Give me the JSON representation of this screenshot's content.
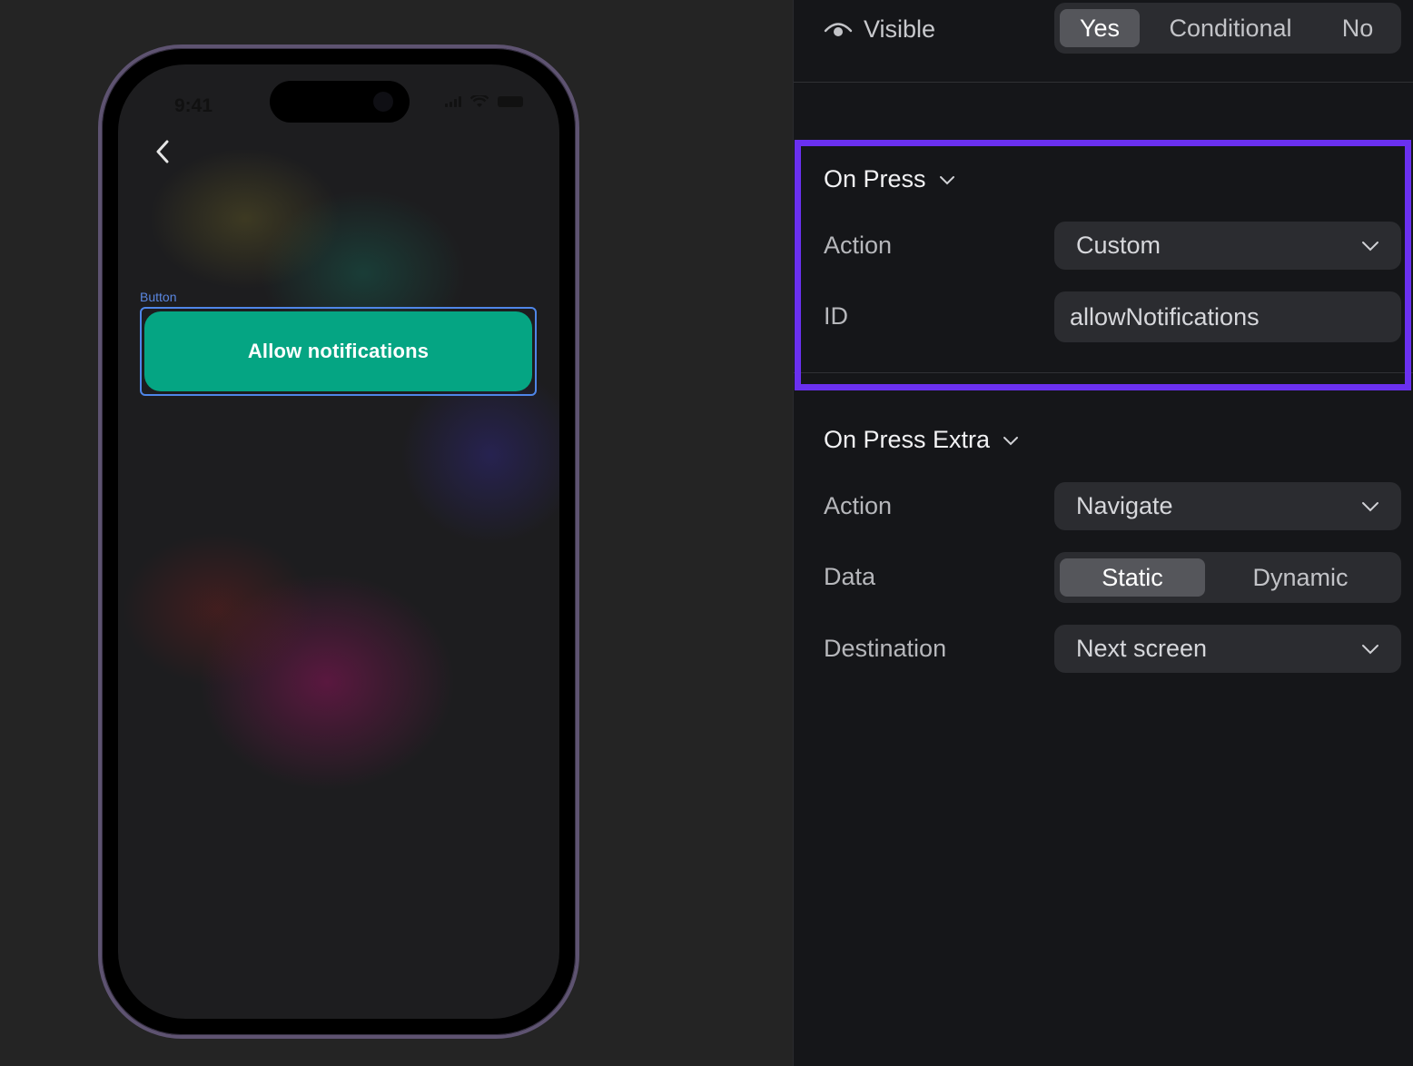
{
  "phone": {
    "status_time": "9:41",
    "button_caption": "Button",
    "button_label": "Allow notifications"
  },
  "panel": {
    "visible": {
      "label": "Visible",
      "options": [
        "Yes",
        "Conditional",
        "No"
      ],
      "selected": "Yes"
    },
    "on_press": {
      "title": "On Press",
      "action_label": "Action",
      "action_value": "Custom",
      "id_label": "ID",
      "id_value": "allowNotifications"
    },
    "on_press_extra": {
      "title": "On Press Extra",
      "action_label": "Action",
      "action_value": "Navigate",
      "data_label": "Data",
      "data_options": [
        "Static",
        "Dynamic"
      ],
      "data_selected": "Static",
      "destination_label": "Destination",
      "destination_value": "Next screen"
    }
  },
  "colors": {
    "accent_highlight": "#6a30f0",
    "button_green": "#05a583",
    "selection_blue": "#4f86e8"
  }
}
